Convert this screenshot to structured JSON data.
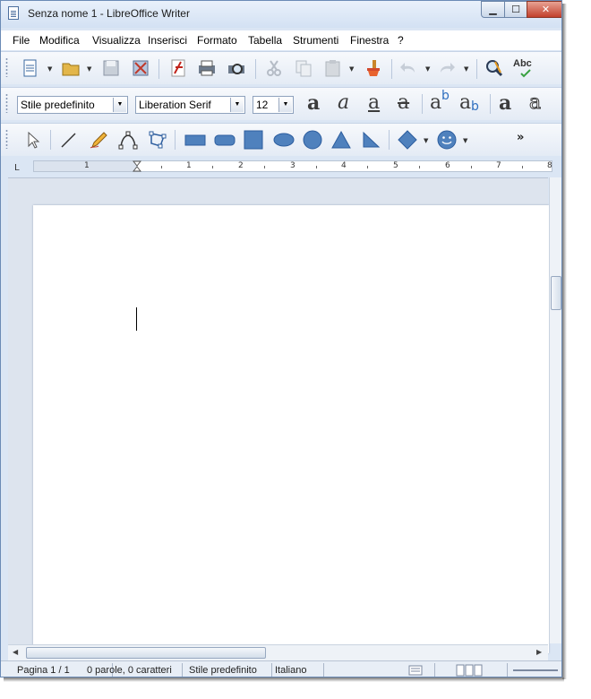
{
  "window": {
    "title": "Senza nome 1 - LibreOffice Writer",
    "controls": {
      "minimize": "▁",
      "maximize": "☐",
      "close": "✕"
    }
  },
  "menu": [
    "File",
    "Modifica",
    "Visualizza",
    "Inserisci",
    "Formato",
    "Tabella",
    "Strumenti",
    "Finestra",
    "?"
  ],
  "standard_toolbar": {
    "icons": [
      "new-document-icon",
      "open-folder-icon",
      "save-icon",
      "export-icon",
      "export-pdf-icon",
      "print-icon",
      "print-preview-icon",
      "cut-icon",
      "copy-icon",
      "paste-icon",
      "format-paintbrush-icon",
      "undo-icon",
      "redo-icon",
      "find-replace-icon",
      "spellcheck-icon"
    ],
    "spellcheck_text": "Abc"
  },
  "formatting_toolbar": {
    "paragraph_style": "Stile predefinito",
    "font_name": "Liberation Serif",
    "font_size": "12",
    "buttons": [
      "a",
      "a",
      "a",
      "a",
      "a",
      "a",
      "a",
      "a"
    ],
    "superscript": "b",
    "subscript": "b"
  },
  "drawing_toolbar": {
    "icons": [
      "select-arrow-icon",
      "line-icon",
      "freeform-pencil-icon",
      "curve-icon",
      "polygon-icon",
      "rectangle-icon",
      "rounded-rectangle-icon",
      "square-icon",
      "ellipse-icon",
      "circle-icon",
      "triangle-icon",
      "right-triangle-icon",
      "diamond-icon",
      "smiley-icon"
    ],
    "overflow": "»"
  },
  "ruler": {
    "tabstop": "L",
    "numbers": [
      "1",
      "1",
      "2",
      "3",
      "4",
      "5",
      "6",
      "7",
      "8"
    ]
  },
  "statusbar": {
    "page": "Pagina 1 / 1",
    "words": "0 parole, 0 caratteri",
    "style": "Stile predefinito",
    "language": "Italiano"
  },
  "colors": {
    "frame": "#dbe6f4",
    "shape_fill": "#4f81bd",
    "close_button": "#c2402c"
  }
}
